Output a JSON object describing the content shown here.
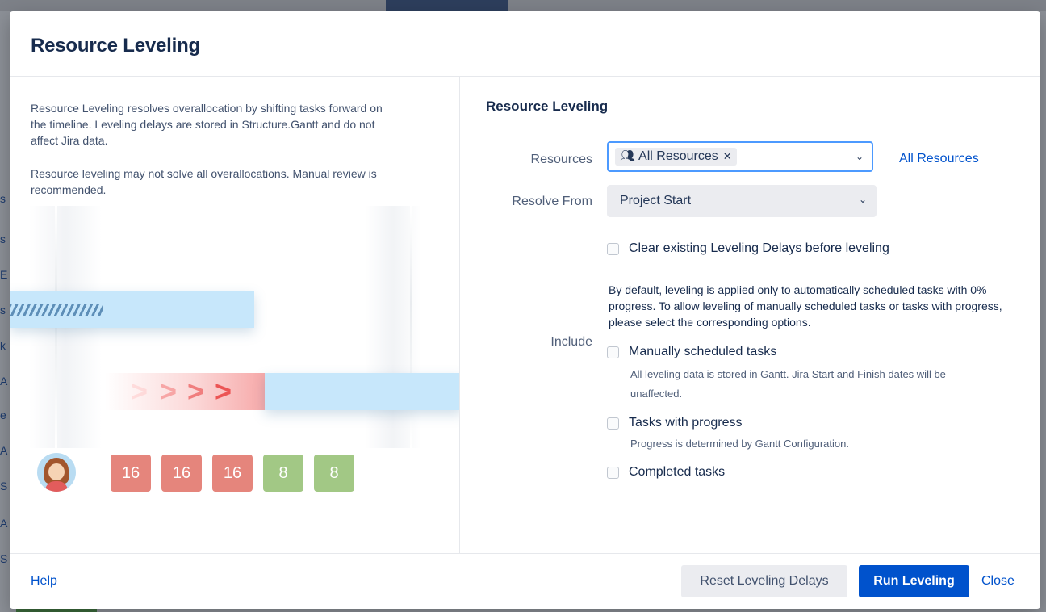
{
  "background": {
    "strip_glyphs": [
      "s",
      "s",
      "E",
      "s",
      "k",
      "A",
      "e",
      "A",
      "S",
      "A",
      "S"
    ]
  },
  "modal": {
    "title": "Resource Leveling",
    "left": {
      "description_1": "Resource Leveling resolves overallocation by shifting tasks forward on the timeline. Leveling delays are stored in Structure.Gantt and do not affect Jira data.",
      "description_2": "Resource leveling may not solve all overallocations. Manual review is recommended.",
      "load_values": [
        "16",
        "16",
        "16",
        "8",
        "8"
      ],
      "load_colors": [
        "#e5857c",
        "#e5857c",
        "#e5857c",
        "#a2c885",
        "#a2c885"
      ]
    },
    "right": {
      "section_title": "Resource Leveling",
      "resources": {
        "label": "Resources",
        "tag_label": "All Resources",
        "tag_icon": "people-icon",
        "link_label": "All Resources"
      },
      "resolve_from": {
        "label": "Resolve From",
        "value": "Project Start"
      },
      "clear_delays": {
        "label": "Clear existing Leveling Delays before leveling",
        "checked": false
      },
      "info_text": "By default, leveling is applied only to automatically scheduled tasks with 0% progress. To allow leveling of manually scheduled tasks or tasks with progress, please select the corresponding options.",
      "include": {
        "label": "Include",
        "options": [
          {
            "label": "Manually scheduled tasks",
            "help": "All leveling data is stored in Gantt. Jira Start and Finish dates will be unaffected.",
            "checked": false
          },
          {
            "label": "Tasks with progress",
            "help": "Progress is determined by Gantt Configuration.",
            "checked": false
          },
          {
            "label": "Completed tasks",
            "help": "",
            "checked": false
          }
        ]
      }
    },
    "footer": {
      "help_label": "Help",
      "reset_label": "Reset Leveling Delays",
      "run_label": "Run Leveling",
      "close_label": "Close"
    },
    "colors": {
      "accent": "#0052cc",
      "focus_border": "#4c9aff",
      "overload": "#e5857c",
      "normal_load": "#a2c885",
      "task_bar": "#c7e7fb"
    }
  }
}
